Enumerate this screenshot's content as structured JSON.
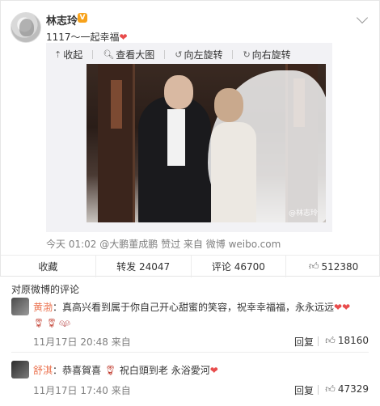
{
  "post": {
    "username": "林志玲",
    "verified_badge": "V",
    "text": "1117～一起幸福",
    "toolbar": {
      "collapse": "收起",
      "view_large": "查看大图",
      "rotate_left": "向左旋转",
      "rotate_right": "向右旋转"
    },
    "photo_watermark": "@林志玲",
    "meta": {
      "time": "今天 01:02",
      "via_user": "@大鹏董成鹏",
      "liked": "赞过",
      "source_prefix": "来自",
      "source": "微博 weibo.com"
    },
    "actions": {
      "favorite": "收藏",
      "repost": "转发 24047",
      "comment": "评论 46700",
      "like": "512380"
    }
  },
  "comments_title": "对原微博的评论",
  "comments": [
    {
      "name": "黄渤",
      "text": "：真高兴看到属于你自己开心甜蜜的笑容，祝幸幸福福，永永远远",
      "time": "11月17日 20:48 来自",
      "reply": "回复",
      "likes": "18160"
    },
    {
      "name": "舒淇",
      "text": "：恭喜賀喜",
      "text2": "祝白頭到老 永浴愛河",
      "time": "11月17日 17:40 来自",
      "reply": "回复",
      "likes": "47329"
    }
  ],
  "colors": {
    "accent_name": "#eb7350",
    "heart": "#e84c4c",
    "meta_gray": "#808080"
  }
}
